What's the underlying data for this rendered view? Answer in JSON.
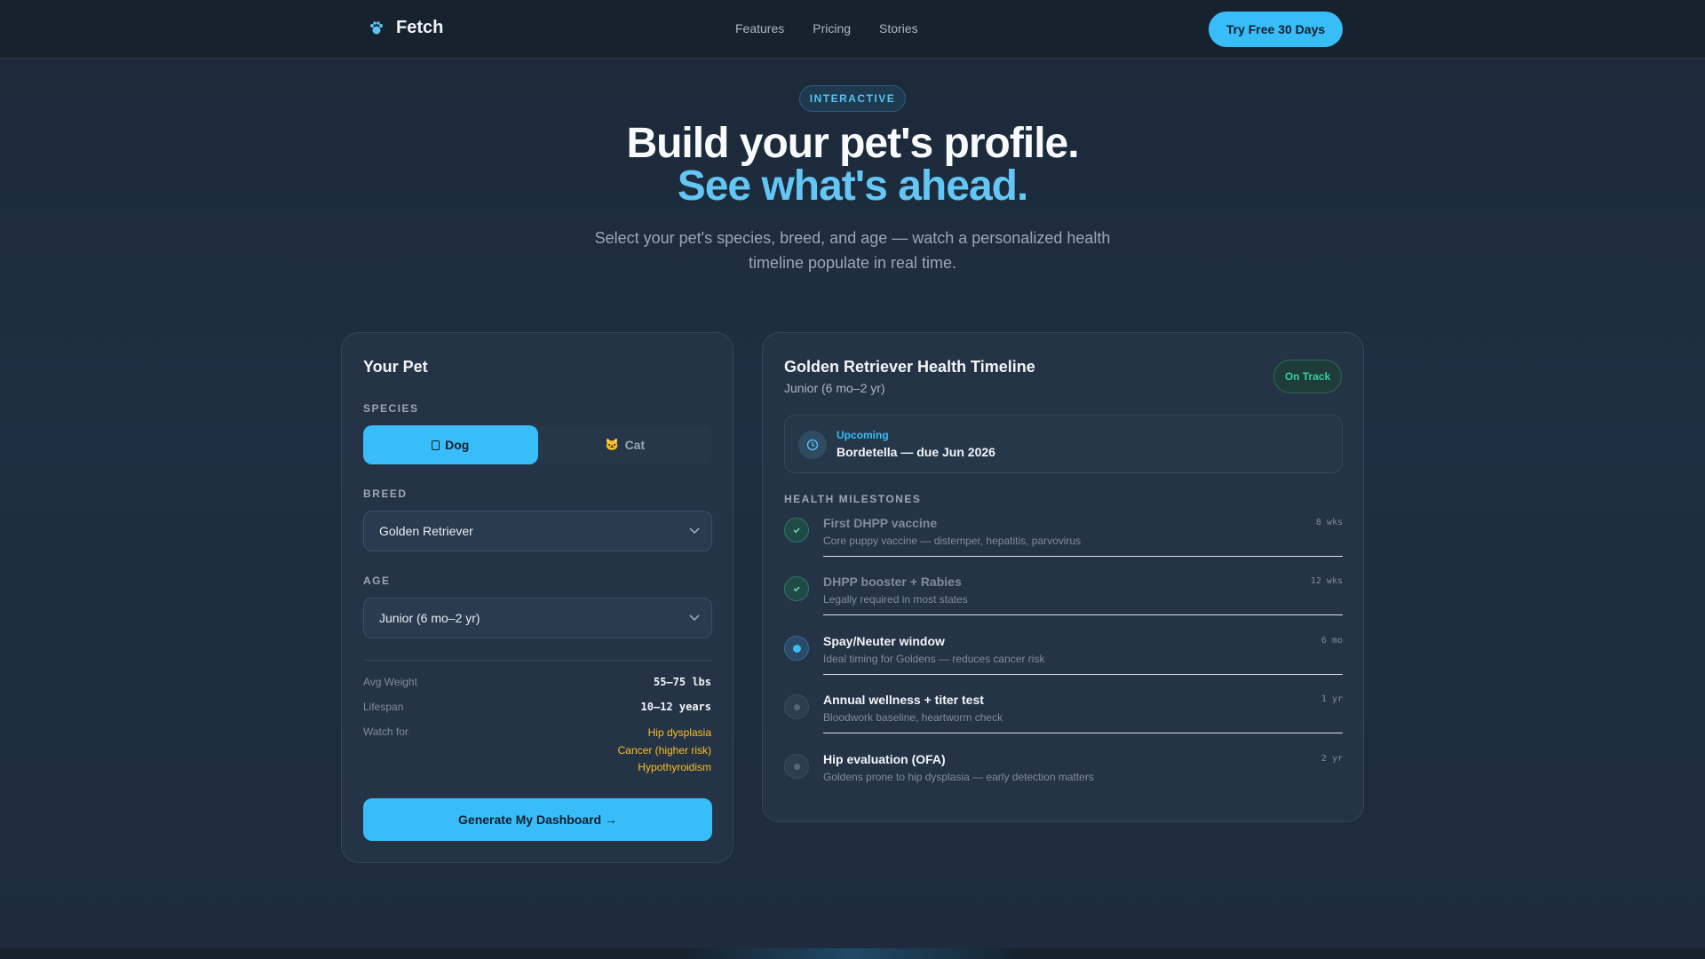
{
  "nav": {
    "brand": "Fetch",
    "links": [
      "Features",
      "Pricing",
      "Stories"
    ],
    "cta": "Try Free 30 Days"
  },
  "hero": {
    "badge": "INTERACTIVE",
    "title_line1": "Build your pet's profile.",
    "title_line2": "See what's ahead.",
    "subtitle": "Select your pet's species, breed, and age — watch a personalized health timeline populate in real time."
  },
  "pet_card": {
    "title": "Your Pet",
    "species_label": "SPECIES",
    "species_options": [
      {
        "label": "Dog",
        "icon": "dog-icon",
        "selected": true
      },
      {
        "label": "Cat",
        "icon": "cat-icon",
        "selected": false
      }
    ],
    "breed_label": "BREED",
    "breed_value": "Golden Retriever",
    "age_label": "AGE",
    "age_value": "Junior (6 mo–2 yr)",
    "stats": {
      "avg_weight_label": "Avg Weight",
      "avg_weight_value": "55–75 lbs",
      "lifespan_label": "Lifespan",
      "lifespan_value": "10–12 years",
      "watch_label": "Watch for",
      "watch_items": [
        "Hip dysplasia",
        "Cancer (higher risk)",
        "Hypothyroidism"
      ]
    },
    "generate_button": "Generate My Dashboard →"
  },
  "timeline_card": {
    "title": "Golden Retriever Health Timeline",
    "subtitle": "Junior (6 mo–2 yr)",
    "status": "On Track",
    "upcoming": {
      "tag": "Upcoming",
      "text": "Bordetella — due Jun 2026"
    },
    "milestones_label": "HEALTH MILESTONES",
    "milestones": [
      {
        "title": "First DHPP vaccine",
        "desc": "Core puppy vaccine — distemper, hepatitis, parvovirus",
        "when": "8 wks",
        "state": "done"
      },
      {
        "title": "DHPP booster + Rabies",
        "desc": "Legally required in most states",
        "when": "12 wks",
        "state": "done"
      },
      {
        "title": "Spay/Neuter window",
        "desc": "Ideal timing for Goldens — reduces cancer risk",
        "when": "6 mo",
        "state": "current"
      },
      {
        "title": "Annual wellness + titer test",
        "desc": "Bloodwork baseline, heartworm check",
        "when": "1 yr",
        "state": "future"
      },
      {
        "title": "Hip evaluation (OFA)",
        "desc": "Goldens prone to hip dysplasia — early detection matters",
        "when": "2 yr",
        "state": "future"
      }
    ]
  },
  "colors": {
    "accent": "#38bdf8",
    "success": "#34d399",
    "warning": "#fbbf24",
    "background": "#1c2a3a"
  }
}
